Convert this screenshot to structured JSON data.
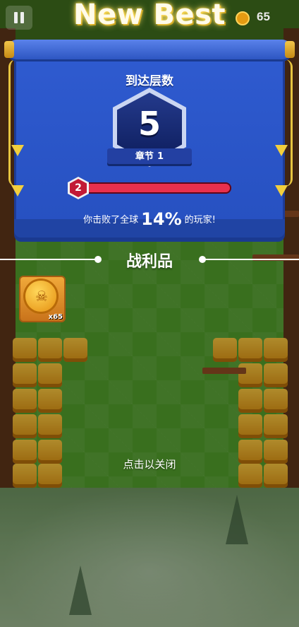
{
  "hud": {
    "pause_icon": "pause-icon",
    "coin_count": "65",
    "coin_icon": "coin-icon"
  },
  "banner": {
    "title": "New Best"
  },
  "result_panel": {
    "floor_label": "到达层数",
    "floor_value": "5",
    "chapter_label": "章节",
    "chapter_value": "1",
    "rank_value": "2",
    "progress_fraction": 1.0,
    "defeat_prefix": "你击败了全球",
    "defeat_percent": "14%",
    "defeat_suffix": "的玩家!"
  },
  "loot": {
    "title": "战利品",
    "items": [
      {
        "icon": "skull-coin-icon",
        "quantity": "x65"
      }
    ]
  },
  "footer": {
    "tap_to_close": "点击以关闭"
  },
  "colors": {
    "panel_blue": "#2f5bd0",
    "progress_red": "#e8304d",
    "banner_text": "#fffbea",
    "block_yellow": "#f3c13d"
  }
}
